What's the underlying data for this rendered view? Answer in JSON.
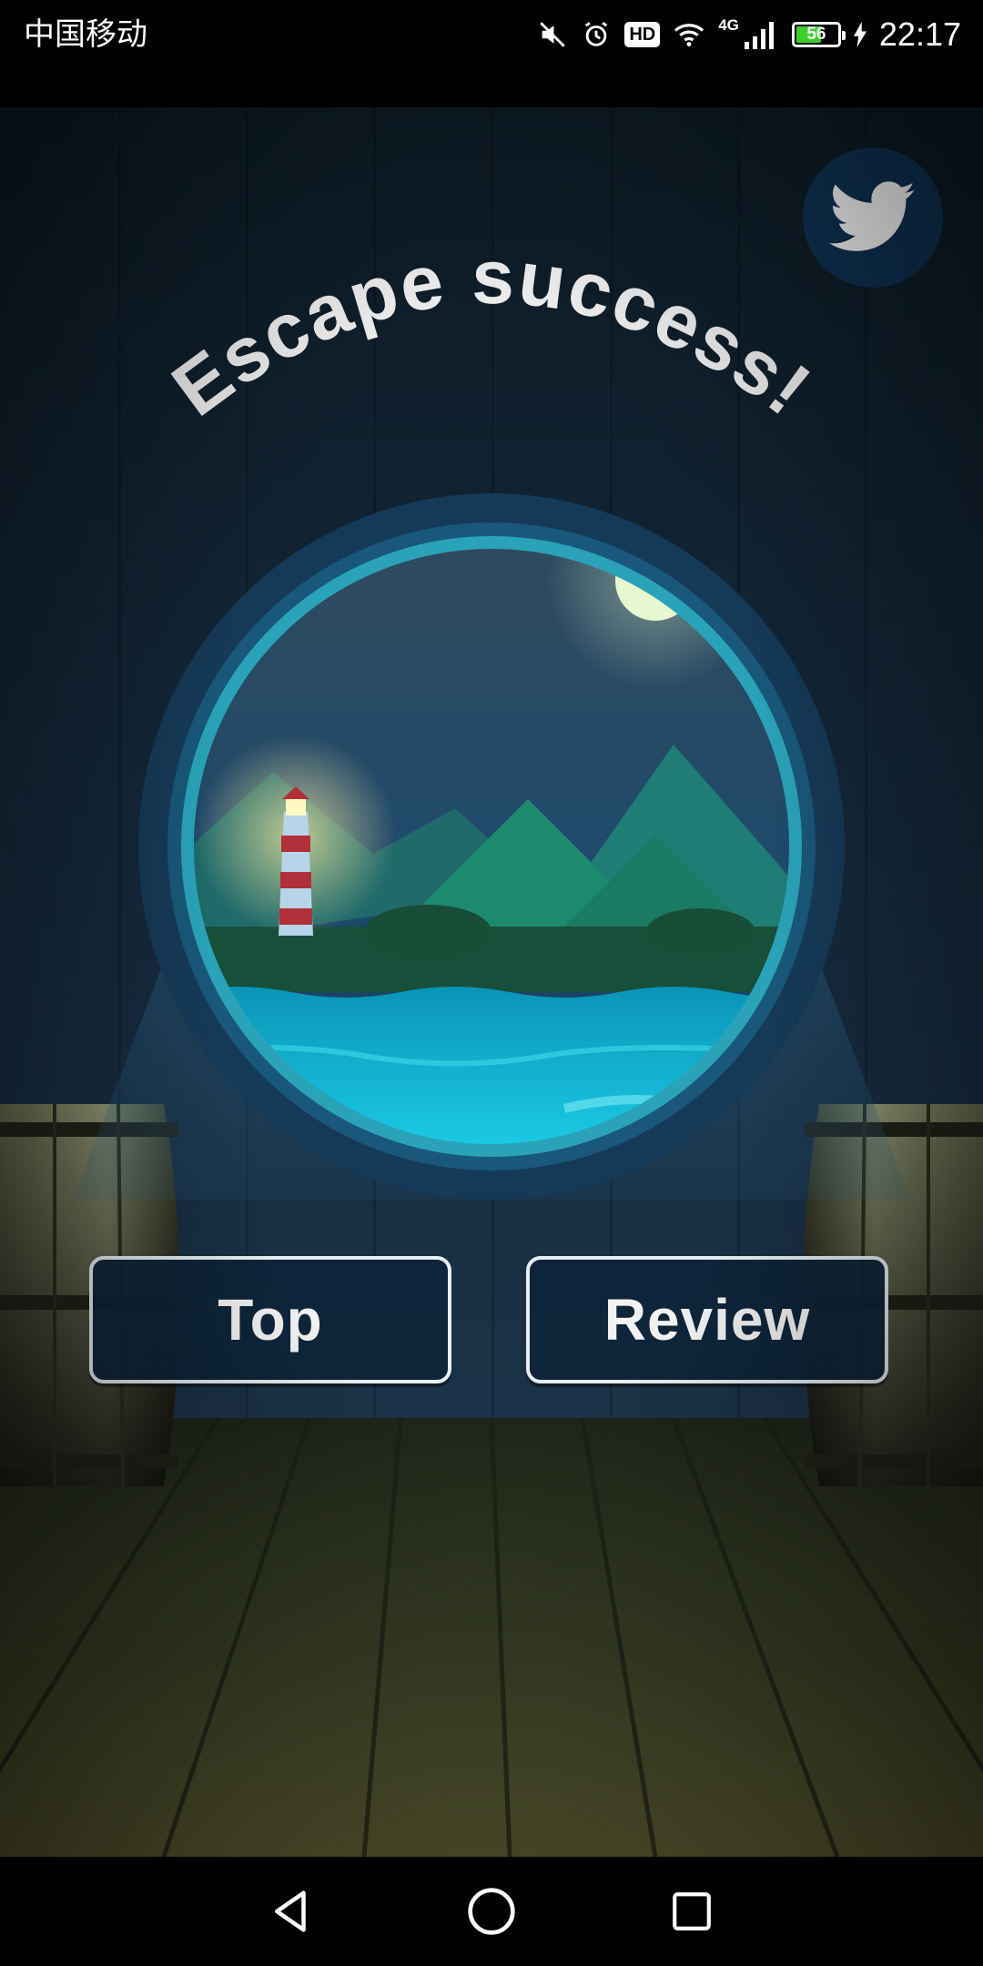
{
  "status_bar": {
    "carrier": "中国移动",
    "network": "4G",
    "battery_level": "56",
    "battery_fraction": 0.56,
    "time": "22:17",
    "hd_label": "HD",
    "icons": [
      "mute-icon",
      "alarm-icon",
      "hd-icon",
      "wifi-icon",
      "signal-icon",
      "battery-icon",
      "charging-icon"
    ]
  },
  "game": {
    "title": "Escape success!",
    "share": {
      "icon": "twitter-icon"
    },
    "buttons": {
      "top_label": "Top",
      "review_label": "Review"
    }
  },
  "nav_bar": {
    "icons": [
      "back-icon",
      "home-icon",
      "recents-icon"
    ]
  },
  "colors": {
    "button_border": "#e8eef2",
    "button_fill": "#0d243a",
    "twitter_bg": "#0f3355",
    "water": "#18c3e0",
    "porthole_ring": "#19587a"
  }
}
